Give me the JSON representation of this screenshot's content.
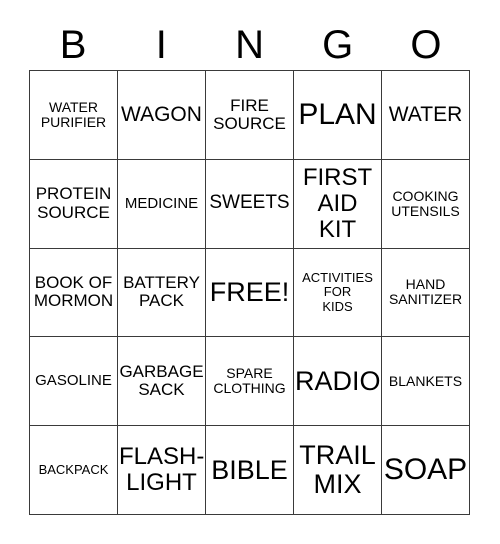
{
  "card": {
    "header_letters": [
      "B",
      "I",
      "N",
      "G",
      "O"
    ],
    "free_space_label": "FREE!",
    "border_color": "#3a3a3a",
    "text_color": "#000000",
    "background_color": "#ffffff",
    "rows": [
      [
        {
          "text": "WATER\nPURIFIER",
          "size": "sm"
        },
        {
          "text": "WAGON",
          "size": "xl"
        },
        {
          "text": "FIRE\nSOURCE",
          "size": "md"
        },
        {
          "text": "PLAN",
          "size": "4xl"
        },
        {
          "text": "WATER",
          "size": "xl"
        }
      ],
      [
        {
          "text": "PROTEIN\nSOURCE",
          "size": "md"
        },
        {
          "text": "MEDICINE",
          "size": "smd"
        },
        {
          "text": "SWEETS",
          "size": "lg"
        },
        {
          "text": "FIRST\nAID\nKIT",
          "size": "2xl"
        },
        {
          "text": "COOKING\nUTENSILS",
          "size": "sm"
        }
      ],
      [
        {
          "text": "BOOK OF\nMORMON",
          "size": "md"
        },
        {
          "text": "BATTERY\nPACK",
          "size": "md"
        },
        {
          "text": "FREE!",
          "size": "3xl"
        },
        {
          "text": "ACTIVITIES\nFOR\nKIDS",
          "size": "xs"
        },
        {
          "text": "HAND\nSANITIZER",
          "size": "sm"
        }
      ],
      [
        {
          "text": "GASOLINE",
          "size": "smd"
        },
        {
          "text": "GARBAGE\nSACK",
          "size": "md"
        },
        {
          "text": "SPARE\nCLOTHING",
          "size": "sm"
        },
        {
          "text": "RADIO",
          "size": "3xl"
        },
        {
          "text": "BLANKETS",
          "size": "sm"
        }
      ],
      [
        {
          "text": "BACKPACK",
          "size": "xs"
        },
        {
          "text": "FLASH-\nLIGHT",
          "size": "2xl"
        },
        {
          "text": "BIBLE",
          "size": "3xl"
        },
        {
          "text": "TRAIL\nMIX",
          "size": "3xl"
        },
        {
          "text": "SOAP",
          "size": "4xl"
        }
      ]
    ]
  }
}
